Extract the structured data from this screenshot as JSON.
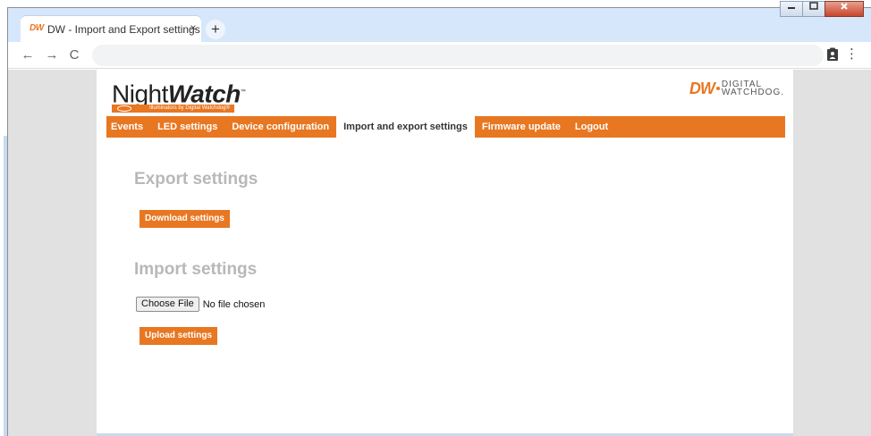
{
  "browser": {
    "tab": {
      "favicon": "DW",
      "title": "DW - Import and Export settings",
      "close_glyph": "×"
    },
    "new_tab_glyph": "+",
    "window_controls": [
      "minimize",
      "maximize",
      "close"
    ],
    "toolbar": {
      "back_glyph": "←",
      "forward_glyph": "→",
      "reload_glyph": "C",
      "address": "",
      "menu_glyph": "⋮"
    }
  },
  "header": {
    "brand": {
      "name_plain": "Night",
      "name_bold": "Watch",
      "trademark": "™",
      "tagline": "Illuminators by Digital Watchdog®"
    },
    "vendor_logo": {
      "mark": "DW",
      "word1": "DIGITAL",
      "word2": "WATCHDOG."
    }
  },
  "nav": {
    "items": [
      {
        "label": "Events",
        "active": false
      },
      {
        "label": "LED settings",
        "active": false
      },
      {
        "label": "Device configuration",
        "active": false
      },
      {
        "label": "Import and export settings",
        "active": true
      },
      {
        "label": "Firmware update",
        "active": false
      },
      {
        "label": "Logout",
        "active": false
      }
    ]
  },
  "export": {
    "title": "Export settings",
    "button_label": "Download settings"
  },
  "import": {
    "title": "Import settings",
    "choose_file_label": "Choose File",
    "file_status": "No file chosen",
    "button_label": "Upload settings"
  },
  "colors": {
    "accent": "#e87722",
    "section_title": "#b8b8b8",
    "page_bg": "#e1e1e1"
  }
}
